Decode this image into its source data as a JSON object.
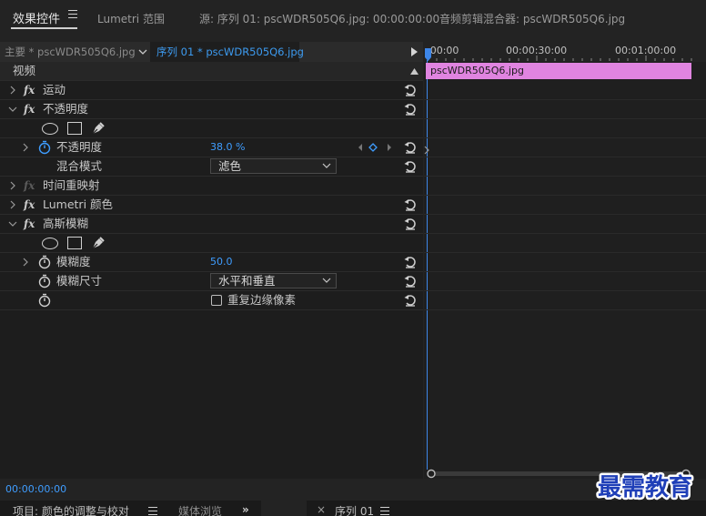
{
  "tabs": [
    {
      "label": "效果控件"
    },
    {
      "label": "Lumetri 范围"
    },
    {
      "label": "源: 序列 01: pscWDR505Q6.jpg: 00:00:00:00"
    },
    {
      "label": "音频剪辑混合器: pscWDR505Q6.jpg"
    }
  ],
  "source_bar": {
    "main_label": "主要 * pscWDR505Q6.jpg",
    "sequence_label": "序列 01 * pscWDR505Q6.jpg"
  },
  "rows": {
    "video_header": "视频",
    "motion": "运动",
    "opacity": "不透明度",
    "opacity_param": "不透明度",
    "opacity_value": "38.0 %",
    "blend_mode": "混合模式",
    "blend_mode_value": "滤色",
    "time_remap": "时间重映射",
    "lumetri": "Lumetri 颜色",
    "gaussian": "高斯模糊",
    "blurriness": "模糊度",
    "blurriness_value": "50.0",
    "blur_dimensions": "模糊尺寸",
    "blur_dimensions_value": "水平和垂直",
    "repeat_edge": "重复边缘像素"
  },
  "timeline": {
    "tc_start": ":00:00",
    "tc_mid": "00:00:30:00",
    "tc_end": "00:01:00:00",
    "clip_name": "pscWDR505Q6.jpg"
  },
  "current_timecode": "00:00:00:00",
  "bottom_tabs": {
    "project": "项目: 颜色的调整与校对",
    "media": "媒体浏览",
    "sequence": "序列 01"
  },
  "watermark": "最需教育",
  "colors": {
    "accent": "#3f9dff",
    "clip": "#e084e0",
    "watermark": "#1f3fb8"
  }
}
